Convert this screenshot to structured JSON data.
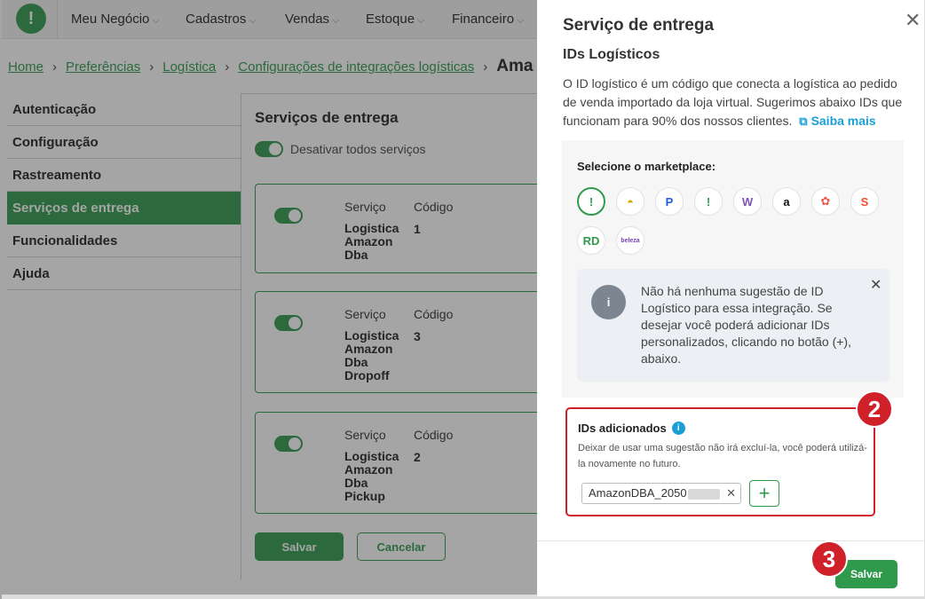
{
  "topbar": {
    "logo_glyph": "!",
    "menu": [
      "Meu Negócio",
      "Cadastros",
      "Vendas",
      "Estoque",
      "Financeiro"
    ]
  },
  "breadcrumb": {
    "items": [
      "Home",
      "Preferências",
      "Logística",
      "Configurações de integrações logísticas"
    ],
    "current": "Ama"
  },
  "sidebar": {
    "items": [
      {
        "label": "Autenticação"
      },
      {
        "label": "Configuração"
      },
      {
        "label": "Rastreamento"
      },
      {
        "label": "Serviços de entrega"
      },
      {
        "label": "Funcionalidades"
      },
      {
        "label": "Ajuda"
      }
    ],
    "active_index": 3
  },
  "main": {
    "title": "Serviços de entrega",
    "disable_all_label": "Desativar todos serviços",
    "col_service": "Serviço",
    "col_code": "Código",
    "services": [
      {
        "name": "Logistica Amazon Dba",
        "code": "1"
      },
      {
        "name": "Logistica Amazon Dba Dropoff",
        "code": "3"
      },
      {
        "name": "Logistica Amazon Dba Pickup",
        "code": "2"
      }
    ],
    "save_label": "Salvar",
    "cancel_label": "Cancelar"
  },
  "drawer": {
    "title": "Serviço de entrega",
    "close_glyph": "✕",
    "subtitle": "IDs Logísticos",
    "description": "O ID logístico é um código que conecta a logística ao pedido de venda importado da loja virtual. Sugerimos abaixo IDs que funcionam para 90% dos nossos clientes.",
    "saiba_mais": "Saiba mais",
    "marketplace_label": "Selecione o marketplace:",
    "marketplaces": [
      {
        "icon": "bling-icon",
        "glyph": "!",
        "color": "#2f9a4c"
      },
      {
        "icon": "mercado-livre-icon",
        "glyph": "◓",
        "color": "#d4a400"
      },
      {
        "icon": "magalu-icon",
        "glyph": "P",
        "color": "#1f5fd4"
      },
      {
        "icon": "bling-alt-icon",
        "glyph": "!",
        "color": "#2f9a4c"
      },
      {
        "icon": "woo-icon",
        "glyph": "W",
        "color": "#7f54b3"
      },
      {
        "icon": "amazon-icon",
        "glyph": "a",
        "color": "#111111"
      },
      {
        "icon": "pinwheel-icon",
        "glyph": "✿",
        "color": "#e85a4f"
      },
      {
        "icon": "shopee-icon",
        "glyph": "S",
        "color": "#ee4d2d"
      },
      {
        "icon": "rd-icon",
        "glyph": "RD",
        "color": "#2f9a4c"
      },
      {
        "icon": "beleza-icon",
        "glyph": "beleza",
        "color": "#7a3fb0"
      }
    ],
    "info_text": "Não há nenhuma sugestão de ID Logístico para essa integração. Se desejar você poderá adicionar IDs personalizados, clicando no botão (+), abaixo.",
    "info_close": "✕",
    "ids_title": "IDs adicionados",
    "ids_help": "Deixar de usar uma sugestão não irá excluí-la, você poderá utilizá-la novamente no futuro.",
    "id_chip_value": "AmazonDBA_2050",
    "id_chip_remove": "✕",
    "add_glyph": "+",
    "save_label": "Salvar",
    "step_2": "2",
    "step_3": "3"
  },
  "colors": {
    "brand_green": "#2f9a4c",
    "highlight_red": "#d0202a",
    "link_blue": "#1a9fd4"
  }
}
